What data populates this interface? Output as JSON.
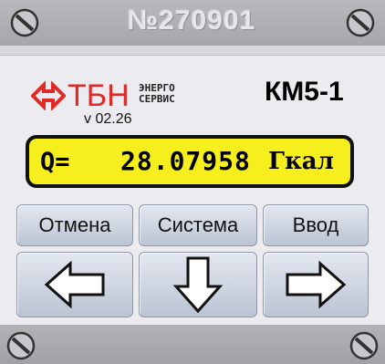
{
  "header": {
    "serial_number": "№270901"
  },
  "brand": {
    "name": "ТБН",
    "sub_line1": "ЭНЕРГО",
    "sub_line2": "СЕРВИС",
    "version": "v 02.26",
    "model": "КМ5-1",
    "logo_color": "#e12a26"
  },
  "display": {
    "label": "Q=",
    "value": "28.07958",
    "unit": "Гкал",
    "background_color": "#f7ee1e"
  },
  "buttons": {
    "cancel_label": "Отмена",
    "system_label": "Система",
    "enter_label": "Ввод",
    "left_icon": "arrow-left-icon",
    "down_icon": "arrow-down-icon",
    "right_icon": "arrow-right-icon"
  },
  "icons": {
    "screws": "screw-icon",
    "logo": "tbn-logo-icon"
  }
}
